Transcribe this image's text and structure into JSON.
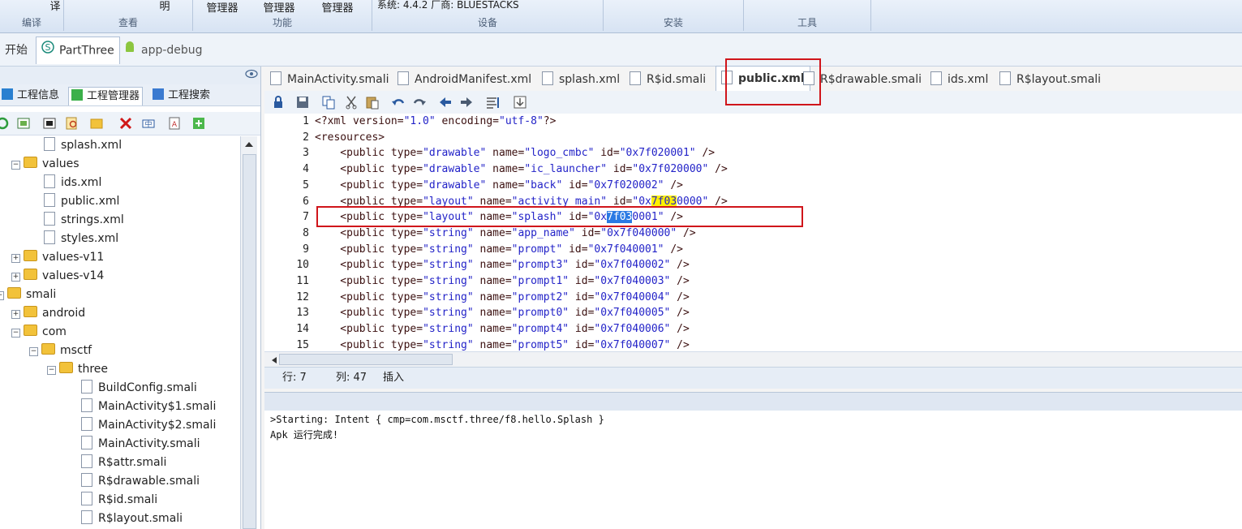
{
  "ribbon": {
    "groups": [
      {
        "label": "编译",
        "buttons": [
          "译"
        ]
      },
      {
        "label": "查看",
        "buttons": [
          "明"
        ]
      },
      {
        "label": "功能",
        "buttons": [
          "管理器",
          "管理器",
          "管理器"
        ]
      },
      {
        "label": "设备",
        "buttons": [
          "系统: 4.4.2  厂商: BLUESTACKS"
        ]
      },
      {
        "label": "安装",
        "buttons": []
      },
      {
        "label": "工具",
        "buttons": []
      }
    ]
  },
  "top_tabs": [
    "开始",
    "PartThree",
    "app-debug"
  ],
  "left": {
    "tabs": [
      "工程信息",
      "工程管理器",
      "工程搜索"
    ],
    "tree": [
      {
        "label": "splash.xml",
        "type": "file"
      },
      {
        "label": "values",
        "type": "folder"
      },
      {
        "label": "ids.xml",
        "type": "file"
      },
      {
        "label": "public.xml",
        "type": "file"
      },
      {
        "label": "strings.xml",
        "type": "file"
      },
      {
        "label": "styles.xml",
        "type": "file"
      },
      {
        "label": "values-v11",
        "type": "folder"
      },
      {
        "label": "values-v14",
        "type": "folder"
      },
      {
        "label": "smali",
        "type": "folder"
      },
      {
        "label": "android",
        "type": "folder"
      },
      {
        "label": "com",
        "type": "folder"
      },
      {
        "label": "msctf",
        "type": "folder"
      },
      {
        "label": "three",
        "type": "folder"
      },
      {
        "label": "BuildConfig.smali",
        "type": "file"
      },
      {
        "label": "MainActivity$1.smali",
        "type": "file"
      },
      {
        "label": "MainActivity$2.smali",
        "type": "file"
      },
      {
        "label": "MainActivity.smali",
        "type": "file"
      },
      {
        "label": "R$attr.smali",
        "type": "file"
      },
      {
        "label": "R$drawable.smali",
        "type": "file"
      },
      {
        "label": "R$id.smali",
        "type": "file"
      },
      {
        "label": "R$layout.smali",
        "type": "file"
      }
    ]
  },
  "editor_tabs": [
    "MainActivity.smali",
    "AndroidManifest.xml",
    "splash.xml",
    "R$id.smali",
    "public.xml",
    "R$drawable.smali",
    "ids.xml",
    "R$layout.smali"
  ],
  "active_tab": "public.xml",
  "code": [
    {
      "n": "1",
      "t": "<?xml version=\"1.0\" encoding=\"utf-8\"?>"
    },
    {
      "n": "2",
      "t": "<resources>"
    },
    {
      "n": "3",
      "t": "    <public type=\"drawable\" name=\"logo_cmbc\" id=\"0x7f020001\" />"
    },
    {
      "n": "4",
      "t": "    <public type=\"drawable\" name=\"ic_launcher\" id=\"0x7f020000\" />"
    },
    {
      "n": "5",
      "t": "    <public type=\"drawable\" name=\"back\" id=\"0x7f020002\" />"
    },
    {
      "n": "6",
      "t": "    <public type=\"layout\" name=\"activity_main\" id=\"0x7f030000\" />"
    },
    {
      "n": "7",
      "t": "    <public type=\"layout\" name=\"splash\" id=\"0x7f030001\" />"
    },
    {
      "n": "8",
      "t": "    <public type=\"string\" name=\"app_name\" id=\"0x7f040000\" />"
    },
    {
      "n": "9",
      "t": "    <public type=\"string\" name=\"prompt\" id=\"0x7f040001\" />"
    },
    {
      "n": "10",
      "t": "    <public type=\"string\" name=\"prompt3\" id=\"0x7f040002\" />"
    },
    {
      "n": "11",
      "t": "    <public type=\"string\" name=\"prompt1\" id=\"0x7f040003\" />"
    },
    {
      "n": "12",
      "t": "    <public type=\"string\" name=\"prompt2\" id=\"0x7f040004\" />"
    },
    {
      "n": "13",
      "t": "    <public type=\"string\" name=\"prompt0\" id=\"0x7f040005\" />"
    },
    {
      "n": "14",
      "t": "    <public type=\"string\" name=\"prompt4\" id=\"0x7f040006\" />"
    },
    {
      "n": "15",
      "t": "    <public type=\"string\" name=\"prompt5\" id=\"0x7f040007\" />"
    }
  ],
  "status": {
    "row": "行: 7",
    "col": "列: 47",
    "mode": "插入"
  },
  "output": [
    ">Starting: Intent { cmp=com.msctf.three/f8.hello.Splash }",
    "Apk 运行完成!"
  ]
}
